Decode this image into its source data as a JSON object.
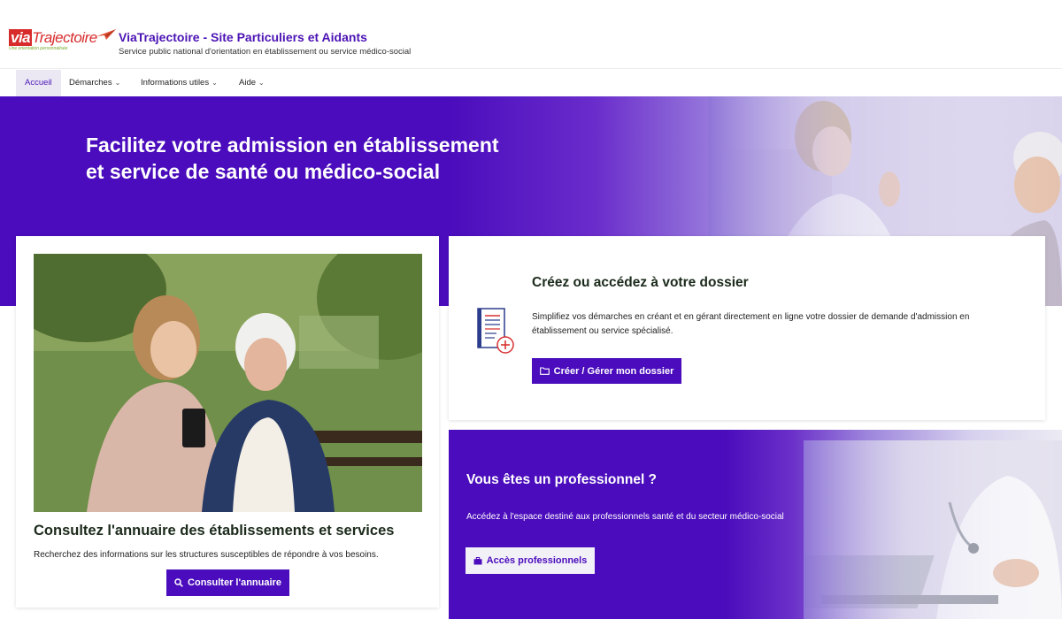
{
  "header": {
    "logo": {
      "via": "via",
      "trajectoire": "Trajectoire",
      "tagline": "Une orientation personnalisée"
    },
    "title": "ViaTrajectoire - Site Particuliers et Aidants",
    "subtitle": "Service public national d'orientation en établissement ou service médico-social"
  },
  "nav": {
    "items": [
      {
        "label": "Accueil",
        "active": true,
        "has_dropdown": false
      },
      {
        "label": "Démarches",
        "active": false,
        "has_dropdown": true
      },
      {
        "label": "Informations utiles",
        "active": false,
        "has_dropdown": true
      },
      {
        "label": "Aide",
        "active": false,
        "has_dropdown": true
      }
    ],
    "chevron": "⌄"
  },
  "hero": {
    "title_line1": "Facilitez votre admission en établissement",
    "title_line2": "et service de santé ou médico-social"
  },
  "annuaire": {
    "title": "Consultez l'annuaire des établissements et services",
    "description": "Recherchez des informations sur les structures susceptibles de répondre à vos besoins.",
    "button_label": "Consulter l'annuaire",
    "button_icon": "search-icon"
  },
  "dossier": {
    "title": "Créez ou accédez à votre dossier",
    "description": "Simplifiez vos démarches en créant et en gérant directement en ligne votre dossier de demande d'admission en établissement ou service spécialisé.",
    "button_label": "Créer / Gérer mon dossier",
    "button_icon": "folder-icon",
    "icon": "document-add-icon"
  },
  "professionnel": {
    "title": "Vous êtes un professionnel ?",
    "description": "Accédez à l'espace destiné aux professionnels santé et du secteur médico-social",
    "button_label": "Accès professionnels",
    "button_icon": "briefcase-icon"
  },
  "colors": {
    "primary": "#4a0cbc",
    "brand_red": "#d82c2c",
    "title_purple": "#4b14b4",
    "text_dark": "#1b2a1b"
  }
}
